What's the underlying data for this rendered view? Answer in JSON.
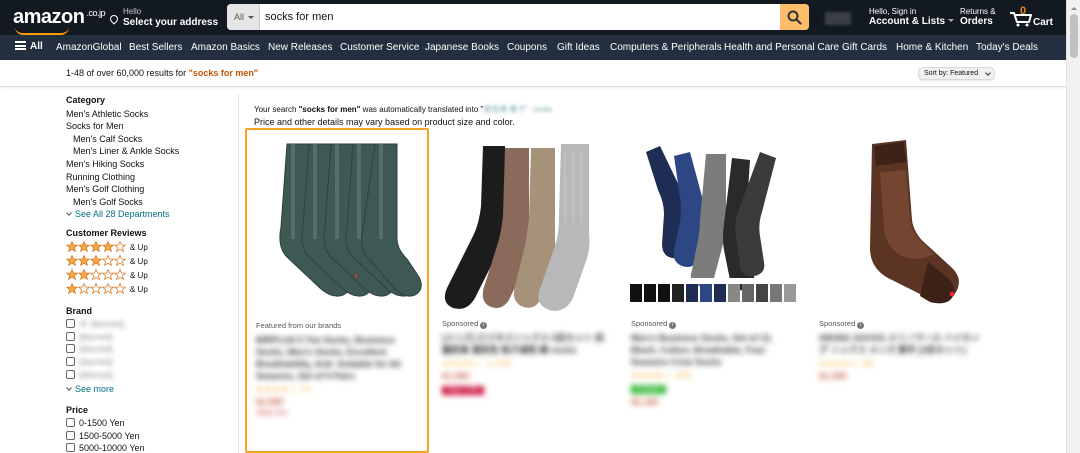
{
  "header": {
    "logo_text": "amazon",
    "logo_tld": ".co.jp",
    "address_line1": "Hello",
    "address_line2": "Select your address",
    "search_category": "All",
    "search_query": "socks for men",
    "account_line1": "Hello, Sign in",
    "account_line2": "Account & Lists",
    "returns_line1": "Returns &",
    "returns_line2": "Orders",
    "cart_count": "0",
    "cart_label": "Cart",
    "accent_color": "#febd69",
    "icons": [
      "location-pin-icon",
      "search-icon",
      "cart-icon",
      "caret-down-icon"
    ]
  },
  "subnav": {
    "all_label": "All",
    "items": [
      "AmazonGlobal",
      "Best Sellers",
      "Amazon Basics",
      "New Releases",
      "Customer Service",
      "Japanese Books",
      "Coupons",
      "Gift Ideas",
      "Computers & Peripherals",
      "Health and Personal Care",
      "Gift Cards",
      "Home & Kitchen",
      "Today's Deals"
    ]
  },
  "results": {
    "count_text": "1-48 of over 60,000 results for",
    "term": "\"socks for men\"",
    "sort_label": "Sort by:",
    "sort_value": "Featured"
  },
  "sidebar": {
    "category_heading": "Category",
    "categories": [
      {
        "label": "Men's Athletic Socks",
        "indent": false
      },
      {
        "label": "Socks for Men",
        "indent": false
      },
      {
        "label": "Men's Calf Socks",
        "indent": true
      },
      {
        "label": "Men's Liner & Ankle Socks",
        "indent": true
      },
      {
        "label": "Men's Hiking Socks",
        "indent": false
      },
      {
        "label": "Running Clothing",
        "indent": false
      },
      {
        "label": "Men's Golf Clothing",
        "indent": false
      },
      {
        "label": "Men's Golf Socks",
        "indent": true
      }
    ],
    "see_all": "See All 28 Departments",
    "reviews_heading": "Customer Reviews",
    "review_rows": [
      {
        "stars": 4,
        "label": "& Up"
      },
      {
        "stars": 3,
        "label": "& Up"
      },
      {
        "stars": 2,
        "label": "& Up"
      },
      {
        "stars": 1,
        "label": "& Up"
      }
    ],
    "brand_heading": "Brand",
    "brands": [
      "ネ (blurred)",
      "(blurred)",
      "(blurred)",
      "(blurred)",
      "(blurred)"
    ],
    "see_more": "See more",
    "price_heading": "Price",
    "prices": [
      "0-1500 Yen",
      "1500-5000 Yen",
      "5000-10000 Yen"
    ],
    "star_color": "#f3a847"
  },
  "notice": {
    "prefix": "Your search ",
    "term": "\"socks for men\"",
    "mid": " was automatically translated into \"",
    "translated": "男性用 靴下",
    "suffix": "\". Undo",
    "line2": "Price and other details may vary based on product size and color."
  },
  "products": [
    {
      "tag": "Featured from our brands",
      "sponsored": false,
      "selected": true,
      "blur_title": "BIRPLUS 5 Toe Socks, Business Socks, Men's Socks, Excellent Breathability, Anti- Suitable for All Seasons, Set of 5 Pairs",
      "blur_rating": "★★★★☆ 23",
      "blur_price": "¥2,980",
      "blur_extra": "Ships free",
      "art": "green-toe-socks"
    },
    {
      "tag": "Sponsored",
      "sponsored": true,
      "selected": false,
      "blur_title": "[メンズ] ビジネスソックス 5足セット 抗菌防臭 通気性 吸汗速乾 綿 socks",
      "blur_rating": "★★★★☆ 1,200",
      "blur_price": "¥1,980",
      "blur_extra": "Save 10%",
      "art": "multi-crew-socks"
    },
    {
      "tag": "Sponsored",
      "sponsored": true,
      "selected": false,
      "blur_title": "Men's Business Socks, Set of 12, Black, Cotton, Breathable, Four Seasons Crew Socks",
      "blur_rating": "★★★★☆ 285",
      "blur_price": "¥2,180",
      "blur_extra": "Coupon",
      "art": "twelve-pack-socks"
    },
    {
      "tag": "Sponsored",
      "sponsored": true,
      "selected": false,
      "blur_title": "HIKING SOCKS メリノウール ハイキング ソックス メンズ 厚手 [3足セット]",
      "blur_rating": "★★★★☆ 96",
      "blur_price": "¥1,999",
      "blur_extra": "",
      "art": "brown-hiking-socks"
    }
  ]
}
